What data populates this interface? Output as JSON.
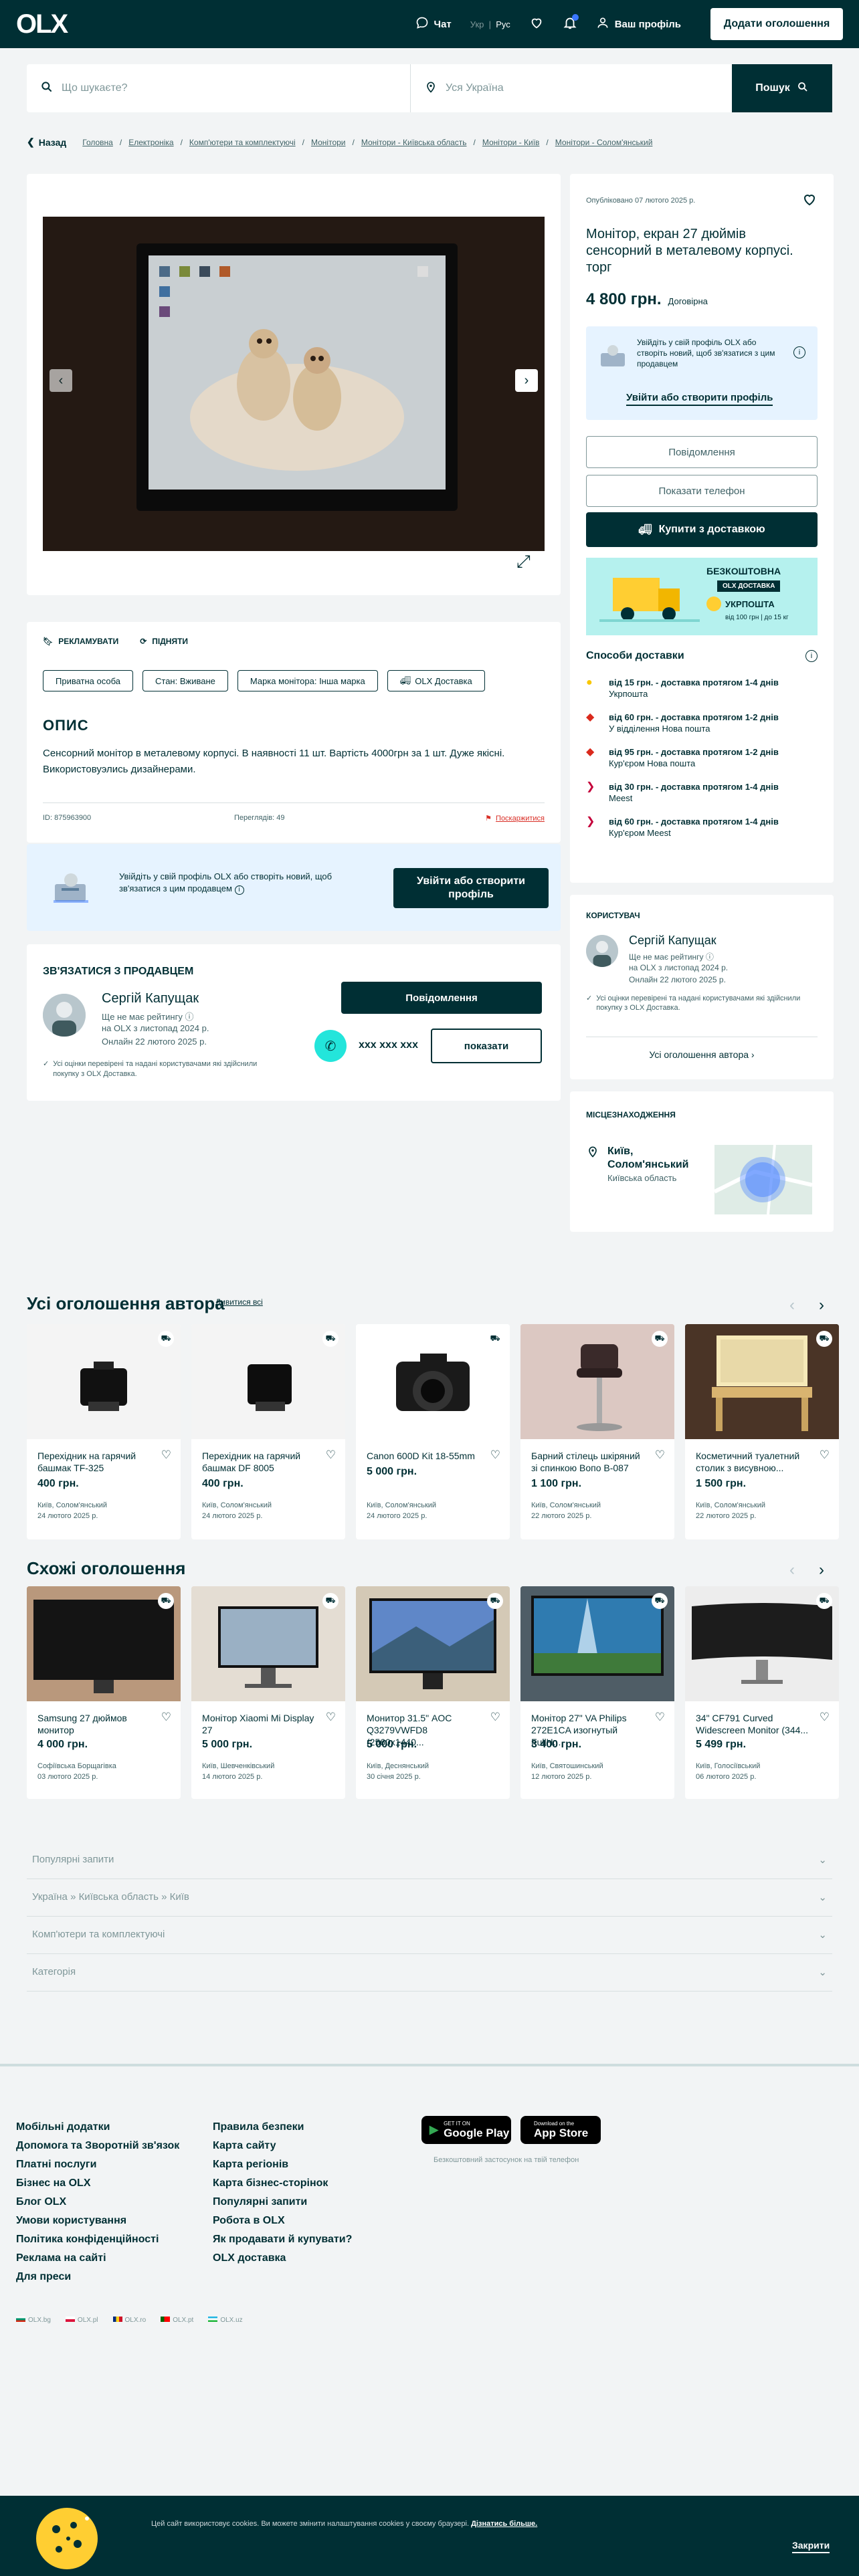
{
  "header": {
    "logo": "OLX",
    "chat": "Чат",
    "lang_uk": "Укр",
    "lang_ru": "Рус",
    "profile": "Ваш профіль",
    "add_ad": "Додати оголошення"
  },
  "search": {
    "placeholder": "Що шукаєте?",
    "location_placeholder": "Уся Україна",
    "button": "Пошук"
  },
  "breadcrumbs": {
    "back": "Назад",
    "items": [
      "Головна",
      "Електроніка",
      "Комп'ютери та комплектуючі",
      "Монітори",
      "Монітори - Київська область",
      "Монітори - Київ",
      "Монітори - Солом'янський"
    ]
  },
  "ad": {
    "published": "Опубліковано 07 лютого 2025 р.",
    "title": "Монітор, екран 27 дюймів сенсорний в металевому корпусі. торг",
    "price": "4 800 грн.",
    "negotiable": "Договірна",
    "promote": "РЕКЛАМУВАТИ",
    "lift": "ПІДНЯТИ",
    "tags": [
      "Приватна особа",
      "Стан: Вживане",
      "Марка монітора: Інша марка",
      "OLX Доставка"
    ],
    "desc_title": "ОПИС",
    "description": "Сенсорний монітор в металевому корпусі. В наявності 11 шт. Вартість 4000грн за 1 шт. Дуже якісні. Використовуэлись дизайнерами.",
    "id": "ID: 875963900",
    "views": "Переглядів: 49",
    "report": "Поскаржитися"
  },
  "login_prompt": {
    "text": "Увійдіть у свій профіль OLX або створіть новий, щоб зв'язатися з цим продавцем",
    "button": "Увійти або створити профіль"
  },
  "actions": {
    "message": "Повідомлення",
    "show_phone": "Показати телефон",
    "buy_delivery": "Купити з доставкою",
    "show": "показати"
  },
  "banner": {
    "free": "БЕЗКОШТОВНА",
    "olx": "OLX ДОСТАВКА",
    "ukr": "УКРПОШТА",
    "sub": "від 100 грн | до 15 кг"
  },
  "delivery": {
    "title": "Способи доставки",
    "items": [
      {
        "main": "від 15 грн. - доставка протягом 1-4 днів",
        "sub": "Укрпошта",
        "color": "#f9c700"
      },
      {
        "main": "від 60 грн. - доставка протягом 1-2 днів",
        "sub": "У відділення Нова пошта",
        "color": "#da291c"
      },
      {
        "main": "від 95 грн. - доставка протягом 1-2 днів",
        "sub": "Кур'єром Нова пошта",
        "color": "#da291c"
      },
      {
        "main": "від 30 грн. - доставка протягом 1-4 днів",
        "sub": "Meest",
        "color": "#c4003a"
      },
      {
        "main": "від 60 грн. - доставка протягом 1-4 днів",
        "sub": "Кур'єром Meest",
        "color": "#c4003a"
      }
    ]
  },
  "seller": {
    "section": "КОРИСТУВАЧ",
    "contact_title": "ЗВ'ЯЗАТИСЯ З ПРОДАВЦЕМ",
    "name": "Сергій Капущак",
    "rating": "Ще не має рейтингу",
    "since": "на OLX з листопад 2024 р.",
    "online": "Онлайн 22 лютого 2025 р.",
    "verified": "Усі оцінки перевірені та надані користувачами які здійснили покупку з OLX Доставка.",
    "all_ads": "Усі оголошення автора",
    "phone": "xxx xxx xxx"
  },
  "location": {
    "title": "МІСЦЕЗНАХОДЖЕННЯ",
    "city": "Київ, Солом'янський",
    "region": "Київська область"
  },
  "author_ads": {
    "title": "Усі оголошення автора",
    "see_all": "Дивитися всі",
    "items": [
      {
        "title": "Перехідник на гарячий башмак TF-325",
        "price": "400 грн.",
        "loc": "Київ, Солом'янський",
        "date": "24 лютого 2025 р."
      },
      {
        "title": "Перехідник на гарячий башмак DF 8005",
        "price": "400 грн.",
        "loc": "Київ, Солом'янський",
        "date": "24 лютого 2025 р."
      },
      {
        "title": "Canon 600D Kit 18-55mm",
        "price": "5 000 грн.",
        "loc": "Київ, Солом'янський",
        "date": "24 лютого 2025 р."
      },
      {
        "title": "Барний стілець шкіряний зі спинкою Вопо В-087",
        "price": "1 100 грн.",
        "loc": "Київ, Солом'янський",
        "date": "22 лютого 2025 р."
      },
      {
        "title": "Косметичний туалетний столик з висувною...",
        "price": "1 500 грн.",
        "loc": "Київ, Солом'янський",
        "date": "22 лютого 2025 р."
      }
    ]
  },
  "similar_ads": {
    "title": "Схожі оголошення",
    "items": [
      {
        "title": "Samsung 27 дюймов монитор",
        "price": "4 000 грн.",
        "loc": "Софіївська Борщагівка",
        "date": "03 лютого 2025 р."
      },
      {
        "title": "Монітор Xiaomi Mi Display 27",
        "price": "5 000 грн.",
        "loc": "Київ, Шевченківський",
        "date": "14 лютого 2025 р."
      },
      {
        "title": "Монитор 31.5\" AOC Q3279VWFD8 (2560x1440...",
        "price": "5 000 грн.",
        "loc": "Київ, Деснянський",
        "date": "30 січня 2025 р."
      },
      {
        "title": "Монітор 27\" VA Philips 272E1CA изогнутый FullH...",
        "price": "3 400 грн.",
        "loc": "Київ, Святошинський",
        "date": "12 лютого 2025 р."
      },
      {
        "title": "34\" CF791 Curved Widescreen Monitor (344...",
        "price": "5 499 грн.",
        "loc": "Київ, Голосіївський",
        "date": "06 лютого 2025 р."
      }
    ]
  },
  "accordions": [
    "Популярні запити",
    "Україна » Київська область » Київ",
    "Комп'ютери та комплектуючі",
    "Категорія"
  ],
  "footer": {
    "col1": [
      "Мобільні додатки",
      "Допомога та Зворотній зв'язок",
      "Платні послуги",
      "Бізнес на OLX",
      "Блог OLX",
      "Умови користування",
      "Політика конфіденційності",
      "Реклама на сайті",
      "Для преси"
    ],
    "col2": [
      "Правила безпеки",
      "Карта сайту",
      "Карта регіонів",
      "Карта бізнес-сторінок",
      "Популярні запити",
      "Робота в OLX",
      "Як продавати й купувати?",
      "OLX доставка"
    ],
    "google_small": "GET IT ON",
    "google": "Google Play",
    "apple_small": "Download on the",
    "apple": "App Store",
    "apps_caption": "Безкоштовний застосунок на твій телефон",
    "countries": [
      "OLX.bg",
      "OLX.pl",
      "OLX.ro",
      "OLX.pt",
      "OLX.uz"
    ]
  },
  "cookie": {
    "text": "Цей сайт використовує cookies. Ви можете змінити налаштування cookies у своєму браузері.",
    "link": "Дізнатись більше.",
    "close": "Закрити"
  }
}
